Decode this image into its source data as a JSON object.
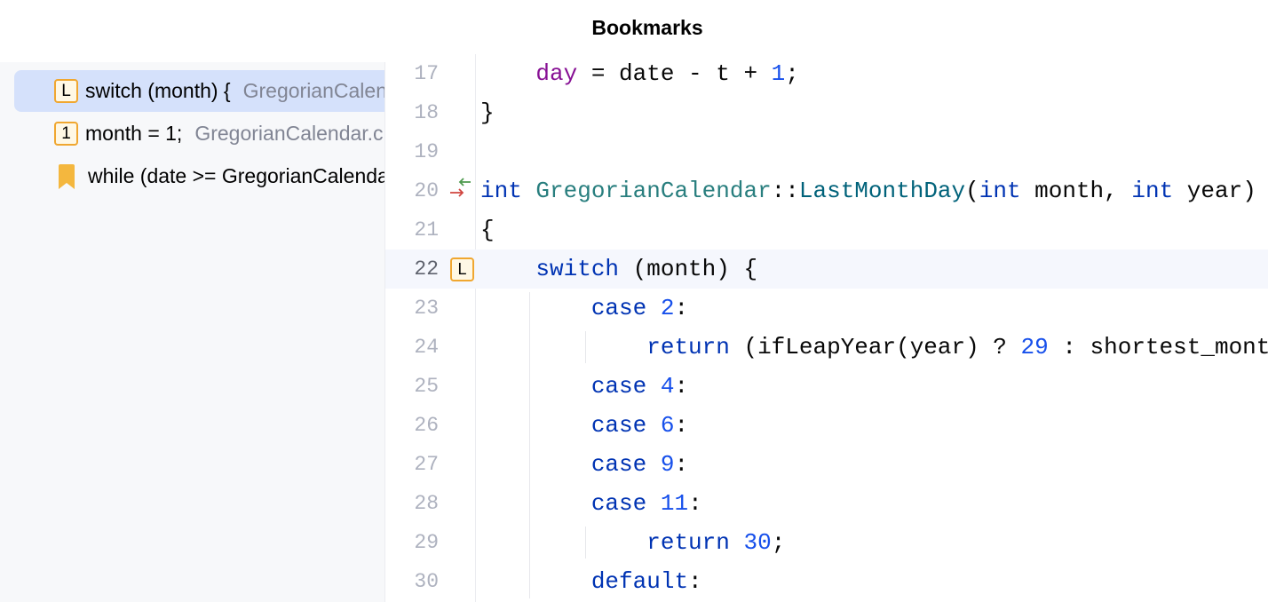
{
  "title": "Bookmarks",
  "bookmarks": [
    {
      "mnemonic": "L",
      "text": "switch (month) {",
      "location": "GregorianCalendar.cpp",
      "selected": true,
      "icon": "mnemonic-badge"
    },
    {
      "mnemonic": "1",
      "text": "month = 1;",
      "location": "GregorianCalendar.cpp",
      "selected": false,
      "icon": "mnemonic-badge"
    },
    {
      "mnemonic": "",
      "text": "while (date >= GregorianCalendar",
      "location": "",
      "selected": false,
      "icon": "bookmark-icon"
    }
  ],
  "editor": {
    "current_line": 22,
    "lines": [
      {
        "n": "17",
        "tokens": [
          [
            "    ",
            ""
          ],
          [
            "day",
            "fld"
          ],
          [
            " = date - t + ",
            ""
          ],
          [
            "1",
            "n"
          ],
          [
            ";",
            ""
          ]
        ]
      },
      {
        "n": "18",
        "tokens": [
          [
            "}",
            ""
          ]
        ]
      },
      {
        "n": "19",
        "tokens": []
      },
      {
        "n": "20",
        "gutter": "implementation-arrows",
        "tokens": [
          [
            "int",
            "k"
          ],
          [
            " ",
            ""
          ],
          [
            "GregorianCalendar",
            "cls"
          ],
          [
            "::",
            ""
          ],
          [
            "LastMonthDay",
            "fn"
          ],
          [
            "(",
            ""
          ],
          [
            "int",
            "k"
          ],
          [
            " month, ",
            ""
          ],
          [
            "int",
            "k"
          ],
          [
            " year)",
            ""
          ]
        ]
      },
      {
        "n": "21",
        "tokens": [
          [
            "{",
            ""
          ]
        ]
      },
      {
        "n": "22",
        "gutter": "L",
        "tokens": [
          [
            "    ",
            ""
          ],
          [
            "switch",
            "k"
          ],
          [
            " (month) {",
            ""
          ]
        ]
      },
      {
        "n": "23",
        "tokens": [
          [
            "        ",
            ""
          ],
          [
            "case",
            "k"
          ],
          [
            " ",
            ""
          ],
          [
            "2",
            "n"
          ],
          [
            ":",
            ""
          ]
        ]
      },
      {
        "n": "24",
        "tokens": [
          [
            "            ",
            ""
          ],
          [
            "return",
            "k"
          ],
          [
            " (ifLeapYear(year) ? ",
            ""
          ],
          [
            "29",
            "n"
          ],
          [
            " : shortest_month_day);",
            ""
          ]
        ]
      },
      {
        "n": "25",
        "tokens": [
          [
            "        ",
            ""
          ],
          [
            "case",
            "k"
          ],
          [
            " ",
            ""
          ],
          [
            "4",
            "n"
          ],
          [
            ":",
            ""
          ]
        ]
      },
      {
        "n": "26",
        "tokens": [
          [
            "        ",
            ""
          ],
          [
            "case",
            "k"
          ],
          [
            " ",
            ""
          ],
          [
            "6",
            "n"
          ],
          [
            ":",
            ""
          ]
        ]
      },
      {
        "n": "27",
        "tokens": [
          [
            "        ",
            ""
          ],
          [
            "case",
            "k"
          ],
          [
            " ",
            ""
          ],
          [
            "9",
            "n"
          ],
          [
            ":",
            ""
          ]
        ]
      },
      {
        "n": "28",
        "tokens": [
          [
            "        ",
            ""
          ],
          [
            "case",
            "k"
          ],
          [
            " ",
            ""
          ],
          [
            "11",
            "n"
          ],
          [
            ":",
            ""
          ]
        ]
      },
      {
        "n": "29",
        "tokens": [
          [
            "            ",
            ""
          ],
          [
            "return",
            "k"
          ],
          [
            " ",
            ""
          ],
          [
            "30",
            "n"
          ],
          [
            ";",
            ""
          ]
        ]
      },
      {
        "n": "30",
        "tokens": [
          [
            "        ",
            ""
          ],
          [
            "default",
            "k"
          ],
          [
            ":",
            ""
          ]
        ]
      }
    ]
  }
}
